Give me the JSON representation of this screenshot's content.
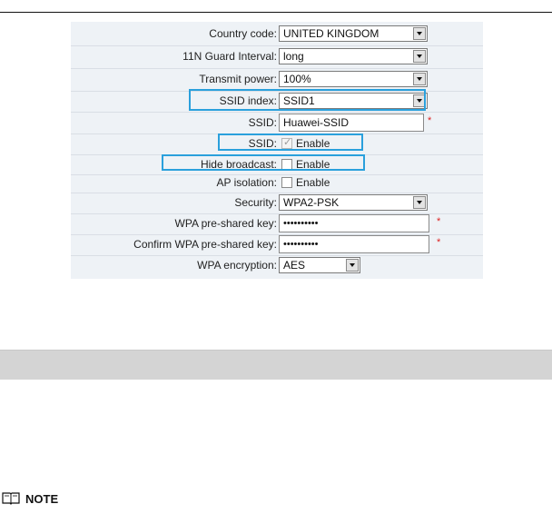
{
  "form": {
    "country_code": {
      "label": "Country code:",
      "value": "UNITED KINGDOM"
    },
    "guard_interval": {
      "label": "11N Guard Interval:",
      "value": "long"
    },
    "transmit_power": {
      "label": "Transmit power:",
      "value": "100%"
    },
    "ssid_index": {
      "label": "SSID index:",
      "value": "SSID1"
    },
    "ssid": {
      "label": "SSID:",
      "value": "Huawei-SSID",
      "required_mark": "*"
    },
    "ssid_enable": {
      "label": "SSID:",
      "checkbox_label": "Enable",
      "checked": true
    },
    "hide_broadcast": {
      "label": "Hide broadcast:",
      "checkbox_label": "Enable",
      "checked": false
    },
    "ap_isolation": {
      "label": "AP isolation:",
      "checkbox_label": "Enable",
      "checked": false
    },
    "security": {
      "label": "Security:",
      "value": "WPA2-PSK"
    },
    "wpa_key": {
      "label": "WPA pre-shared key:",
      "value": "••••••••••",
      "required_mark": "*"
    },
    "wpa_key_confirm": {
      "label": "Confirm WPA pre-shared key:",
      "value": "••••••••••",
      "required_mark": "*"
    },
    "wpa_encryption": {
      "label": "WPA encryption:",
      "value": "AES"
    }
  },
  "note": {
    "text": "NOTE",
    "icon": "book-icon"
  },
  "colors": {
    "highlight": "#2aa0dc",
    "panel_bg": "#eef2f6",
    "band": "#d4d4d4",
    "required": "#dd2222"
  }
}
